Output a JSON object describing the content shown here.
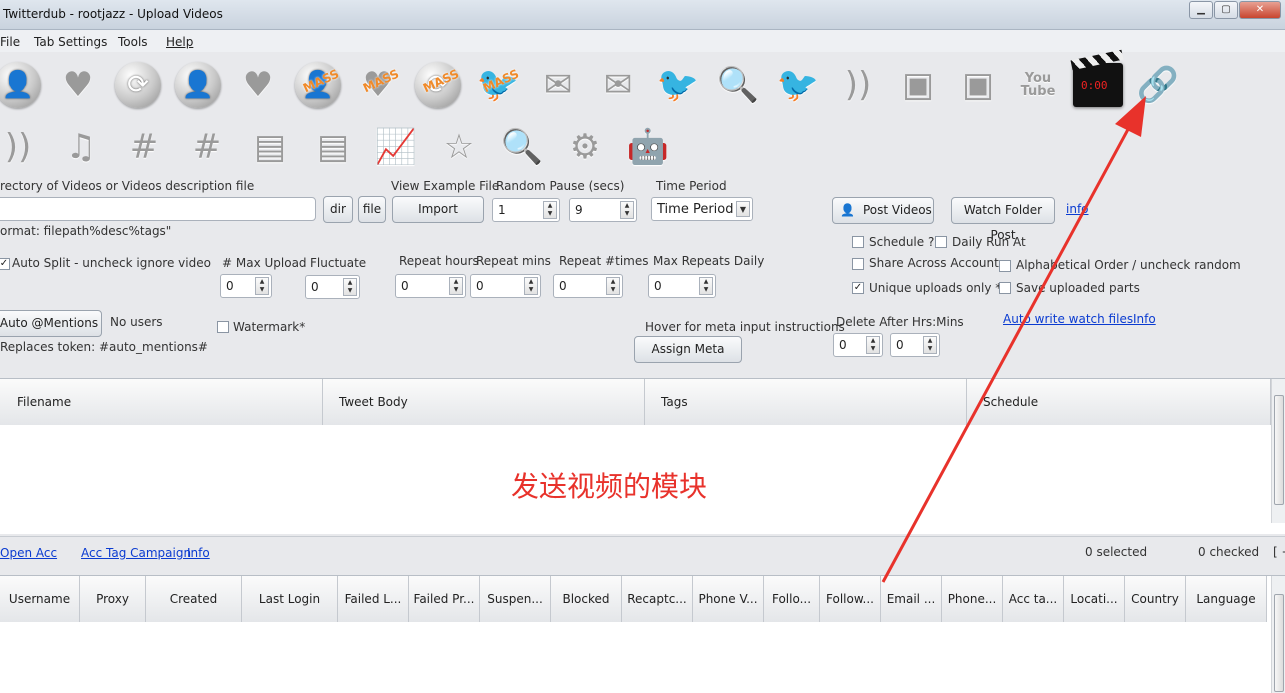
{
  "window": {
    "title": "Twitterdub - rootjazz  - Upload Videos",
    "controls": [
      "minimize",
      "maximize",
      "close"
    ]
  },
  "menu": [
    "File",
    "Tab Settings",
    "Tools",
    "Help"
  ],
  "toolbar_icons_row1": [
    {
      "name": "add-user-icon",
      "glyph": "👤",
      "mass": ""
    },
    {
      "name": "heart-icon",
      "glyph": "♥",
      "mass": ""
    },
    {
      "name": "retweet-icon",
      "glyph": "⟳",
      "mass": ""
    },
    {
      "name": "remove-user-icon",
      "glyph": "👤",
      "mass": ""
    },
    {
      "name": "unlike-icon",
      "glyph": "♥",
      "mass": ""
    },
    {
      "name": "mass-follow-icon",
      "glyph": "👤",
      "mass": "MASS"
    },
    {
      "name": "mass-like-icon",
      "glyph": "♥",
      "mass": "MASS"
    },
    {
      "name": "mass-retweet-icon",
      "glyph": "⟳",
      "mass": "MASS"
    },
    {
      "name": "mass-tweet-icon",
      "glyph": "🐦",
      "mass": "MASS"
    },
    {
      "name": "mail-open-icon",
      "glyph": "✉",
      "mass": ""
    },
    {
      "name": "mail-download-icon",
      "glyph": "✉",
      "mass": ""
    },
    {
      "name": "twitter-bird-icon",
      "glyph": "🐦",
      "mass": ""
    },
    {
      "name": "search-bird-icon",
      "glyph": "🔍",
      "mass": ""
    },
    {
      "name": "bird-users-icon",
      "glyph": "🐦",
      "mass": ""
    },
    {
      "name": "rss-icon",
      "glyph": "))",
      "mass": ""
    },
    {
      "name": "image-bird-icon",
      "glyph": "▣",
      "mass": ""
    },
    {
      "name": "image-rss-icon",
      "glyph": "▣",
      "mass": ""
    },
    {
      "name": "youtube-icon",
      "glyph": "You\nTube",
      "mass": ""
    },
    {
      "name": "video-clapper-icon",
      "glyph": "",
      "mass": ""
    },
    {
      "name": "link-icon",
      "glyph": "🔗",
      "mass": ""
    }
  ],
  "toolbar_icons_row2": [
    {
      "name": "rss-edit-icon",
      "glyph": "))"
    },
    {
      "name": "music-icon",
      "glyph": "♫"
    },
    {
      "name": "hashtag-user-icon",
      "glyph": "#"
    },
    {
      "name": "hashtag-users-icon",
      "glyph": "#"
    },
    {
      "name": "table-icon",
      "glyph": "▤"
    },
    {
      "name": "table-upload-icon",
      "glyph": "▤"
    },
    {
      "name": "chart-icon",
      "glyph": "📈"
    },
    {
      "name": "star-icon",
      "glyph": "☆"
    },
    {
      "name": "magnifier-icon",
      "glyph": "🔍"
    },
    {
      "name": "settings-gear-icon",
      "glyph": "⚙"
    },
    {
      "name": "robot-icon",
      "glyph": "🤖"
    }
  ],
  "form": {
    "dir_label": "rectory of Videos or Videos description file",
    "dir_value": "",
    "dir_button": "dir",
    "file_button": "file",
    "view_example_label": "View Example File",
    "import_button": "Import",
    "random_pause_label": "Random Pause (secs)",
    "random_pause_min": "1",
    "random_pause_max": "9",
    "time_period_label": "Time Period",
    "time_period_value": "Time Period",
    "format_hint": "ormat: filepath%desc%tags\"",
    "post_videos_button": "Post Videos",
    "watch_folder_button": "Watch Folder Post",
    "info_link": "info",
    "schedule_label": "Schedule ?",
    "daily_run_label": "Daily Run At",
    "share_accounts_label": "Share Across Accounts",
    "alphabetical_label": "Alphabetical Order / uncheck random",
    "unique_uploads_label": "Unique uploads only *",
    "save_parts_label": "Save uploaded parts",
    "auto_split_label": "Auto Split - uncheck ignore video",
    "max_upload_label": "# Max Upload",
    "max_upload_value": "0",
    "fluctuate_label": "Fluctuate",
    "fluctuate_value": "0",
    "repeat_hours_label": "Repeat hours",
    "repeat_hours_value": "0",
    "repeat_mins_label": "Repeat mins",
    "repeat_mins_value": "0",
    "repeat_times_label": "Repeat #times",
    "repeat_times_value": "0",
    "max_repeats_label": "Max Repeats Daily",
    "max_repeats_value": "0",
    "auto_mentions_button": "Auto @Mentions",
    "no_users_label": "No users",
    "watermark_label": "Watermark*",
    "hover_meta_label": "Hover for meta input instructions",
    "assign_meta_button": "Assign Meta",
    "delete_after_label": "Delete After Hrs:Mins",
    "delete_hrs": "0",
    "delete_mins": "0",
    "auto_write_link": "Auto write watch files",
    "info_link2": "Info",
    "replaces_token": "Replaces token: #auto_mentions#"
  },
  "checkbox_states": {
    "schedule": false,
    "daily_run": false,
    "share_accounts": false,
    "alphabetical": false,
    "unique_uploads": true,
    "save_parts": false,
    "auto_split": true,
    "watermark": false
  },
  "upload_grid": {
    "columns": [
      "Filename",
      "Tweet Body",
      "Tags",
      "Schedule"
    ],
    "annotation": "发送视频的模块"
  },
  "status": {
    "open_acc": "Open Acc",
    "acc_tag_campaign": "Acc Tag Campaign",
    "info": "Info",
    "selected": "0 selected",
    "checked": "0 checked",
    "more": "[ +"
  },
  "accounts_grid": {
    "columns": [
      "Username",
      "Proxy",
      "Created",
      "Last Login",
      "Failed L...",
      "Failed Pr...",
      "Suspen...",
      "Blocked",
      "Recaptc...",
      "Phone V...",
      "Follo...",
      "Follow...",
      "Email ...",
      "Phone...",
      "Acc ta...",
      "Locati...",
      "Country",
      "Language"
    ]
  },
  "colors": {
    "annotation_red": "#e8322b",
    "link_blue": "#0a3bd1",
    "arrow_red": "#e8322b"
  }
}
